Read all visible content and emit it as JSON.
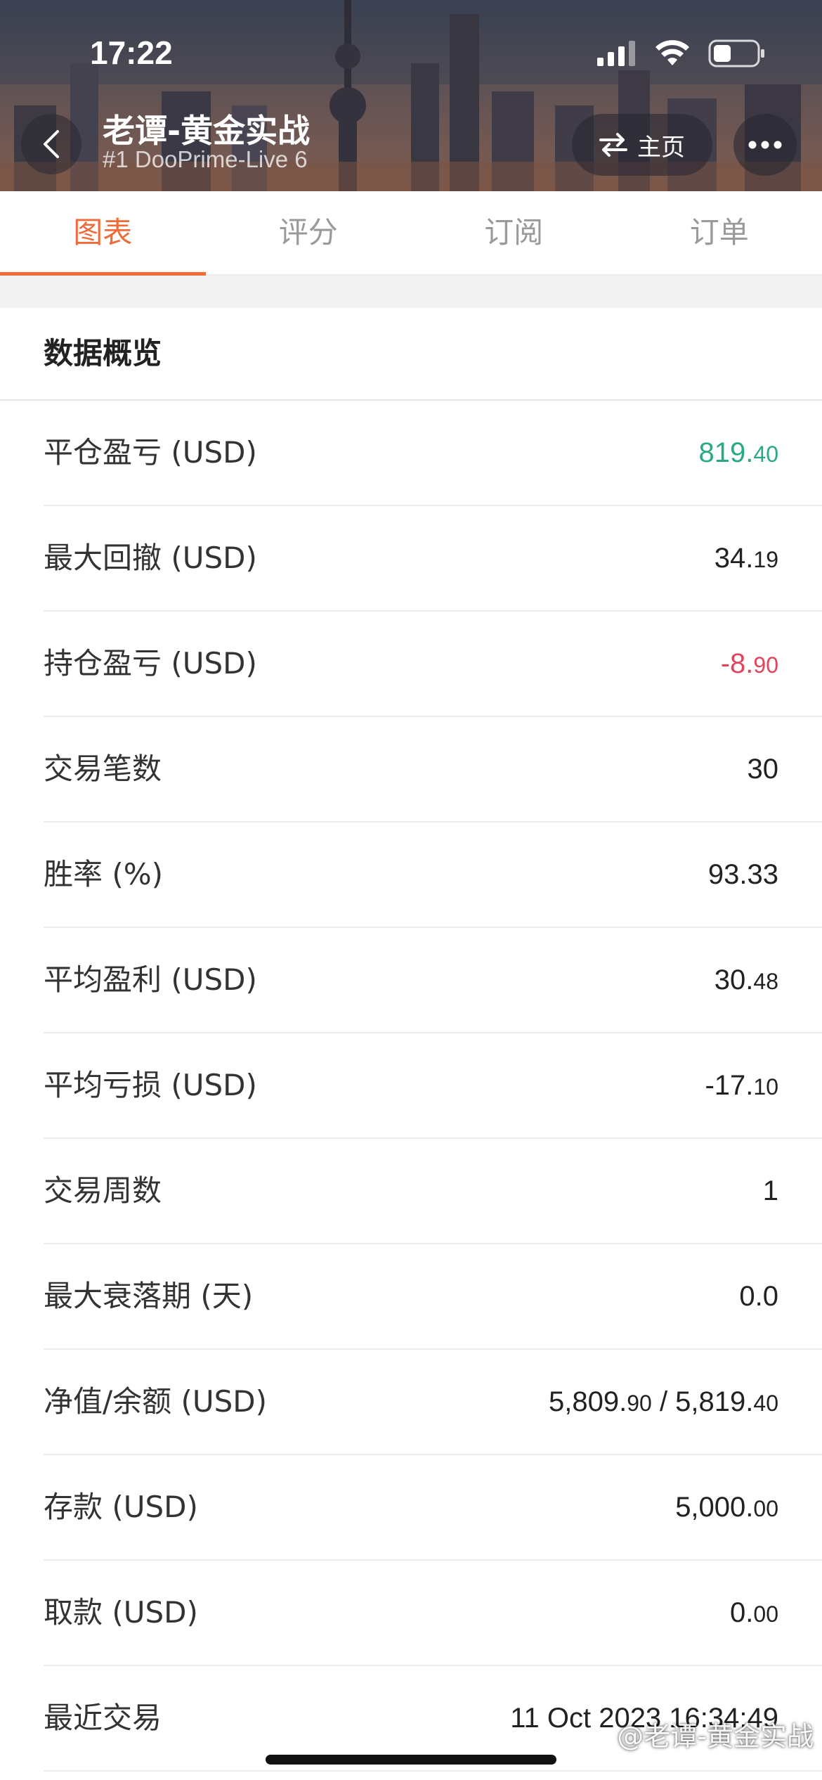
{
  "status_bar": {
    "time": "17:22"
  },
  "header": {
    "title": "老谭-黄金实战",
    "subtitle": "#1 DooPrime-Live 6",
    "home_label": "主页"
  },
  "tabs": [
    {
      "label": "图表",
      "active": true
    },
    {
      "label": "评分",
      "active": false
    },
    {
      "label": "订阅",
      "active": false
    },
    {
      "label": "订单",
      "active": false
    }
  ],
  "section": {
    "title": "数据概览"
  },
  "rows": [
    {
      "label": "平仓盈亏 (USD)",
      "int": "819.",
      "dec": "40",
      "tone": "green"
    },
    {
      "label": "最大回撤 (USD)",
      "int": "34.",
      "dec": "19",
      "tone": ""
    },
    {
      "label": "持仓盈亏 (USD)",
      "int": "-8.",
      "dec": "90",
      "tone": "red"
    },
    {
      "label": "交易笔数",
      "int": "30",
      "dec": "",
      "tone": ""
    },
    {
      "label": "胜率 (%)",
      "int": "93.33",
      "dec": "",
      "tone": ""
    },
    {
      "label": "平均盈利 (USD)",
      "int": "30.",
      "dec": "48",
      "tone": ""
    },
    {
      "label": "平均亏损 (USD)",
      "int": "-17.",
      "dec": "10",
      "tone": ""
    },
    {
      "label": "交易周数",
      "int": "1",
      "dec": "",
      "tone": ""
    },
    {
      "label": "最大衰落期 (天)",
      "int": "0.0",
      "dec": "",
      "tone": ""
    },
    {
      "label": "净值/余额 (USD)",
      "int": "5,809.",
      "dec": "90",
      "int2": " / 5,819.",
      "dec2": "40",
      "tone": ""
    },
    {
      "label": "存款 (USD)",
      "int": "5,000.",
      "dec": "00",
      "tone": ""
    },
    {
      "label": "取款 (USD)",
      "int": "0.",
      "dec": "00",
      "tone": ""
    },
    {
      "label": "最近交易",
      "int": "11 Oct 2023 16:34:49",
      "dec": "",
      "tone": ""
    }
  ],
  "watermark": "@老谭-黄金实战",
  "colors": {
    "accent": "#ef6b3a",
    "positive": "#2aa987",
    "negative": "#e0455c"
  }
}
